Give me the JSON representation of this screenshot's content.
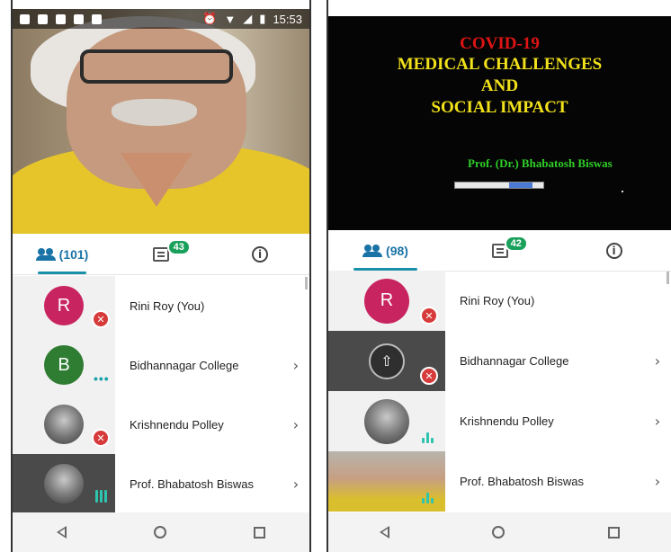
{
  "left": {
    "status": {
      "time": "15:53"
    },
    "tabs": {
      "participants_count": "(101)",
      "chat_badge": "43",
      "info_glyph": "i"
    },
    "participants": [
      {
        "initial": "R",
        "name": "Rini Roy (You)",
        "avatar_color": "#c8245f",
        "status": "muted"
      },
      {
        "initial": "B",
        "name": "Bidhannagar College",
        "avatar_color": "#2f7d32",
        "status": "dots"
      },
      {
        "initial": "",
        "name": "Krishnendu Polley",
        "avatar_color": "photo",
        "status": "muted"
      },
      {
        "initial": "",
        "name": "Prof. Bhabatosh Biswas",
        "avatar_color": "photo",
        "status": "speaking"
      }
    ]
  },
  "right": {
    "slide": {
      "title": "COVID-19",
      "line1": "MEDICAL CHALLENGES",
      "line2": "AND",
      "line3": "SOCIAL IMPACT",
      "author": "Prof. (Dr.) Bhabatosh Biswas"
    },
    "tabs": {
      "participants_count": "(98)",
      "chat_badge": "42",
      "info_glyph": "i"
    },
    "participants": [
      {
        "initial": "R",
        "name": "Rini Roy (You)",
        "avatar_color": "#c8245f",
        "status": "muted"
      },
      {
        "initial": "",
        "name": "Bidhannagar College",
        "avatar_color": "screen-share",
        "status": "speaker-muted"
      },
      {
        "initial": "",
        "name": "Krishnendu Polley",
        "avatar_color": "photo",
        "status": "speaking"
      },
      {
        "initial": "",
        "name": "Prof. Bhabatosh Biswas",
        "avatar_color": "video",
        "status": "speaking"
      }
    ]
  },
  "icons": {
    "mute": "mic-off-icon",
    "chevron": "chevron-right-icon",
    "chevron_glyph": "›",
    "present_glyph": "⇧",
    "mute_glyph": "✕"
  }
}
